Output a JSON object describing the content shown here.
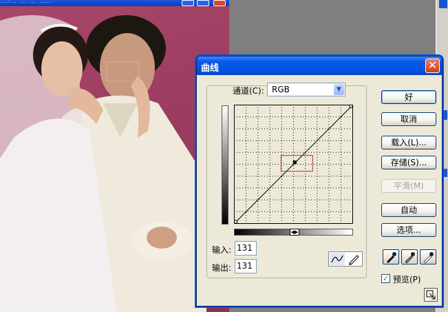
{
  "photo_window": {
    "title_fragment": "...:... ... ... .....",
    "colors": {
      "backdrop": "#9c3c60",
      "titlebar": "#0a3fc0"
    }
  },
  "curves_dialog": {
    "title": "曲线",
    "channel": {
      "label": "通道(C):",
      "value": "RGB"
    },
    "input": {
      "label": "输入:",
      "value": "131"
    },
    "output": {
      "label": "输出:",
      "value": "131"
    },
    "curve_point": {
      "input": 131,
      "output": 131
    },
    "buttons": {
      "ok": "好",
      "cancel": "取消",
      "load": "载入(L)...",
      "save": "存储(S)...",
      "smooth": "平滑(M)",
      "auto": "自动",
      "options": "选项..."
    },
    "preview": {
      "label": "预览(P)",
      "checked": true
    },
    "tools": [
      "curve-point-tool-icon",
      "pencil-tool-icon"
    ],
    "eyedroppers": [
      "black-eyedropper-icon",
      "gray-eyedropper-icon",
      "white-eyedropper-icon"
    ],
    "colors": {
      "accent": "#0054e3",
      "panel": "#ece9d8",
      "selection_box": "#c03030"
    }
  }
}
